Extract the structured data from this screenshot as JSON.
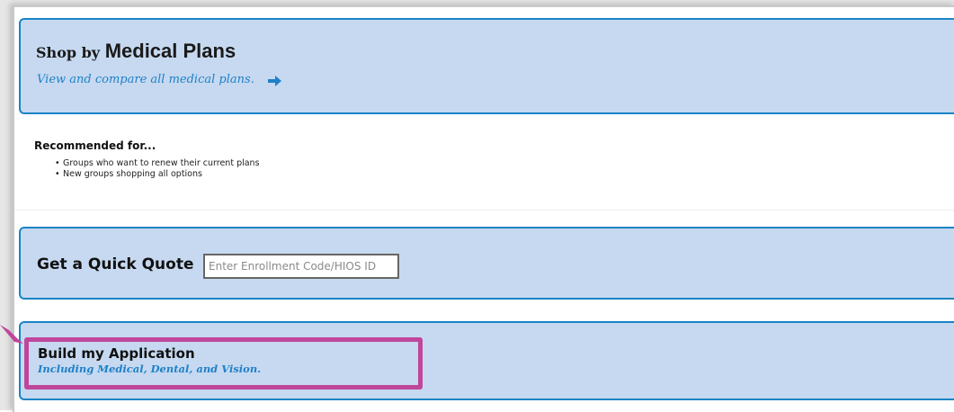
{
  "shop": {
    "title_prefix": "Shop by",
    "title_main": "Medical Plans",
    "link_text": "View and compare all medical plans.",
    "icon": "arrow-right-icon"
  },
  "recommended": {
    "title": "Recommended for...",
    "items": [
      "Groups who want to renew their current plans",
      "New groups shopping all options"
    ]
  },
  "quote": {
    "label": "Get a Quick Quote",
    "placeholder": "Enter Enrollment Code/HIOS ID",
    "value": ""
  },
  "build": {
    "title": "Build my Application",
    "subtitle": "Including Medical, Dental, and Vision."
  },
  "colors": {
    "panel_bg": "#c6d9f0",
    "panel_border": "#1a84c5",
    "link_blue": "#1f80c8",
    "highlight": "#c0469a"
  }
}
